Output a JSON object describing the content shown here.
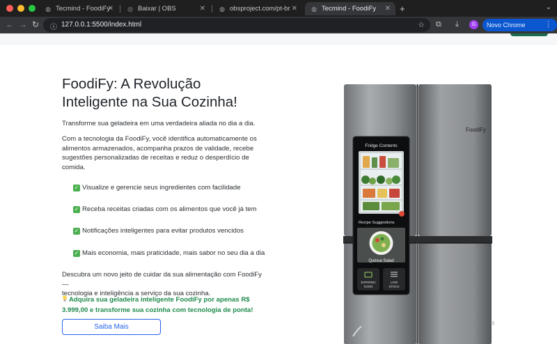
{
  "browser": {
    "tabs": [
      {
        "title": "Tecmind - FoodiFy",
        "active": false
      },
      {
        "title": "Baixar | OBS",
        "active": false
      },
      {
        "title": "obsproject.com/pt-br/welcom",
        "active": false
      },
      {
        "title": "Tecmind - FoodiFy",
        "active": true
      }
    ],
    "url": "127.0.0.1:5500/index.html",
    "update_button": "Novo Chrome disponível",
    "avatar_letter": "G"
  },
  "hero": {
    "title_line1": "FoodiFy: A Revolução",
    "title_line2": "Inteligente na Sua Cozinha!",
    "subtitle": "Transforme sua geladeira em uma verdadeira aliada no dia a dia.",
    "description_lines": [
      "Com a tecnologia da FoodiFy, você identifica automaticamente os",
      "alimentos armazenados, acompanha prazos de validade, recebe",
      "sugestões personalizadas de receitas e reduz o desperdício de",
      "comida."
    ],
    "features": [
      "Visualize e gerencie seus ingredientes com facilidade",
      "Receba receitas criadas com os alimentos que você já tem",
      "Notificações inteligentes para evitar produtos vencidos",
      "Mais economia, mais praticidade, mais sabor no seu dia a dia"
    ],
    "closing_lines": [
      "Descubra um novo jeito de cuidar da sua alimentação com FoodiFy —",
      "tecnologia e inteligência a serviço da sua cozinha."
    ],
    "promo_lines": [
      "Adquira sua geladeira inteligente FoodiFy por apenas R$",
      "3.999,00 e transforme sua cozinha com tecnologia de ponta!"
    ],
    "cta_label": "Saiba Mais"
  },
  "fridge": {
    "brand": "FoodiFy",
    "screen_title": "Fridge Contents",
    "recipe_heading": "Recipe Suggestions",
    "recipe_name": "Quinoa Salad",
    "button_expiring": [
      "EXPIRING",
      "SOON"
    ],
    "button_low_stock": [
      "LOW",
      "STOCK"
    ]
  },
  "colors": {
    "accent_blue": "#2563eb",
    "promo_green": "#1e8a4a",
    "chrome_update": "#0b57d0"
  }
}
